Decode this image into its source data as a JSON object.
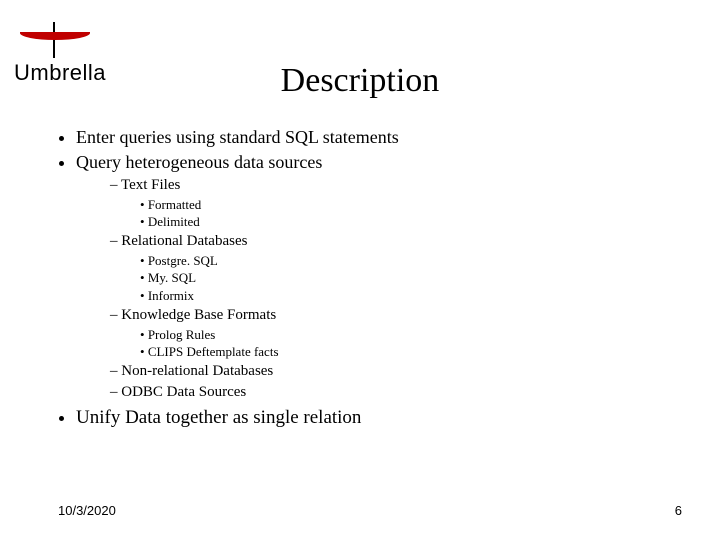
{
  "logo_text": "Umbrella",
  "title": "Description",
  "bullets": {
    "b1": "Enter queries using standard SQL statements",
    "b2": "Query heterogeneous data sources",
    "b2_sub": {
      "s1": "Text Files",
      "s1_items": {
        "i1": "Formatted",
        "i2": "Delimited"
      },
      "s2": "Relational Databases",
      "s2_items": {
        "i1": "Postgre. SQL",
        "i2": "My. SQL",
        "i3": "Informix"
      },
      "s3": "Knowledge Base Formats",
      "s3_items": {
        "i1": "Prolog Rules",
        "i2": "CLIPS Deftemplate facts"
      },
      "s4": "Non-relational Databases",
      "s5": "ODBC Data Sources"
    },
    "b3": "Unify Data together as single relation"
  },
  "footer": {
    "date": "10/3/2020",
    "page": "6"
  }
}
